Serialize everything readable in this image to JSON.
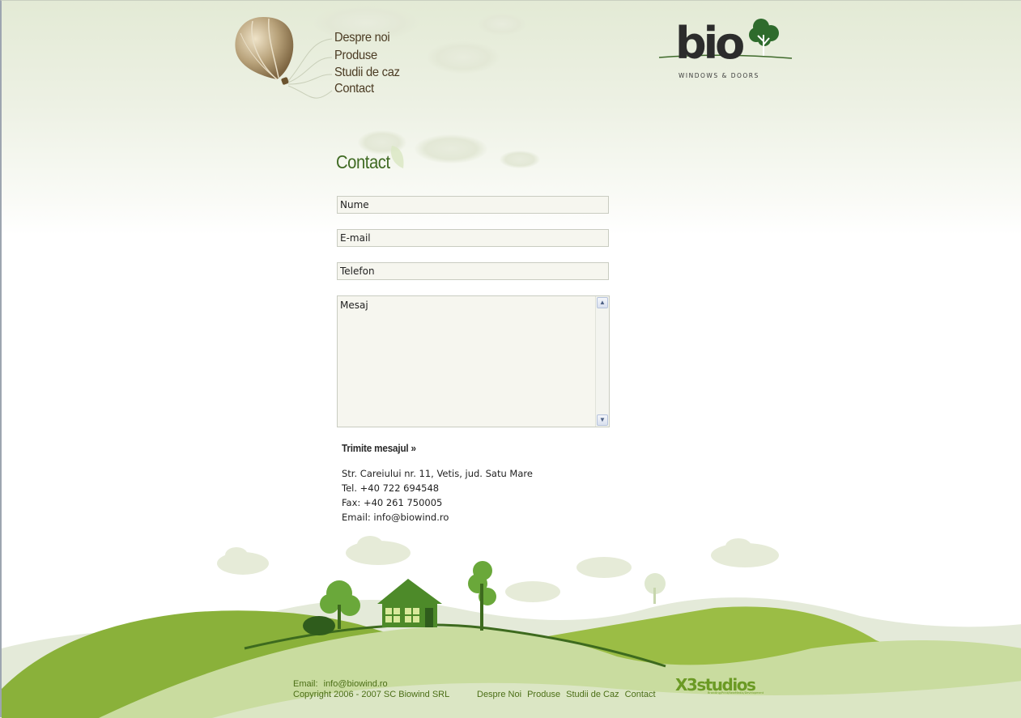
{
  "nav": {
    "items": [
      "Despre noi",
      "Produse",
      "Studii de caz",
      "Contact"
    ]
  },
  "logo": {
    "brand": "bio",
    "tagline": "WINDOWS & DOORS"
  },
  "page_title": "Contact",
  "form": {
    "name_placeholder": "Nume",
    "email_placeholder": "E-mail",
    "phone_placeholder": "Telefon",
    "message_placeholder": "Mesaj",
    "submit_label": "Trimite mesajul »"
  },
  "address": {
    "street": "Str. Careiului nr. 11, Vetis, jud. Satu Mare",
    "phone": "Tel. +40 722 694548",
    "fax": "Fax: +40 261 750005",
    "email": "Email: info@biowind.ro"
  },
  "footer": {
    "email_label": "Email:",
    "email": "info@biowind.ro",
    "copyright": "Copyright 2006 - 2007 SC Biowind SRL",
    "links": [
      "Despre Noi",
      "Produse",
      "Studii de Caz",
      "Contact"
    ],
    "credit": "X3studios",
    "credit_tagline": "Branding/Print/NewMedia/Development"
  },
  "colors": {
    "accent": "#3f6a22",
    "hill_dark": "#8fb33a",
    "hill_light": "#c8dd9a"
  }
}
